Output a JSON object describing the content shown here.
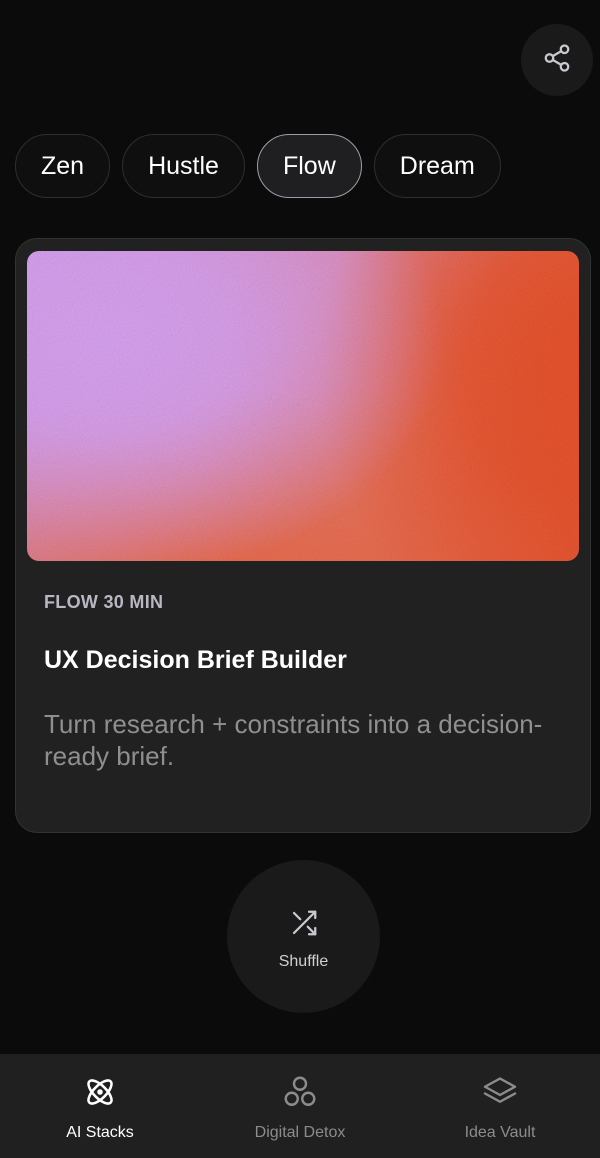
{
  "header": {
    "share_icon": "share-icon"
  },
  "moods": [
    {
      "label": "Zen",
      "active": false
    },
    {
      "label": "Hustle",
      "active": false
    },
    {
      "label": "Flow",
      "active": true
    },
    {
      "label": "Dream",
      "active": false
    }
  ],
  "card": {
    "kicker": "FLOW 30 MIN",
    "title": "UX Decision Brief Builder",
    "description": "Turn research + constraints into a decision-ready brief.",
    "image_colors": [
      "#d9a3f2",
      "#e97660",
      "#e8532d"
    ]
  },
  "shuffle": {
    "label": "Shuffle",
    "icon": "shuffle-icon"
  },
  "nav": {
    "items": [
      {
        "label": "AI Stacks",
        "icon": "atom-icon",
        "active": true
      },
      {
        "label": "Digital Detox",
        "icon": "circles-icon",
        "active": false
      },
      {
        "label": "Idea Vault",
        "icon": "layers-icon",
        "active": false
      }
    ]
  },
  "colors": {
    "background": "#0b0b0b",
    "card": "#212121",
    "active_chip_border": "#9d9da4",
    "muted_text": "#8f8f8f"
  }
}
